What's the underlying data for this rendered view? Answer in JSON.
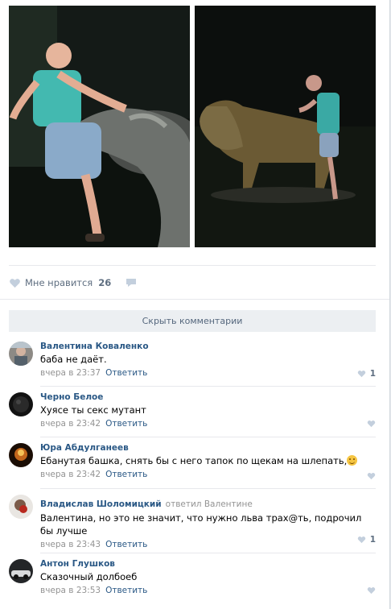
{
  "post": {
    "likes_label": "Мне нравится",
    "likes_count": "26",
    "hide_comments": "Скрыть комментарии"
  },
  "colors": {
    "link": "#2a5885",
    "muted": "#939393",
    "button_bg": "#eceff2"
  },
  "comments": [
    {
      "author": "Валентина Коваленко",
      "note": "",
      "text": "баба не даёт.",
      "date": "вчера в 23:37",
      "reply": "Ответить",
      "likes": "1"
    },
    {
      "author": "Черно Белое",
      "note": "",
      "text": "Хуясе ты секс мутант",
      "date": "вчера в 23:42",
      "reply": "Ответить",
      "likes": ""
    },
    {
      "author": "Юра Абдулганеев",
      "note": "",
      "text": "Ебанутая башка, снять бы с него тапок по щекам на шлепать,",
      "date": "вчера в 23:42",
      "reply": "Ответить",
      "likes": ""
    },
    {
      "author": "Владислав Шоломицкий",
      "note": "ответил Валентине",
      "text": "Валентина, но это не значит, что нужно льва трах@ть, подрочил бы лучше",
      "date": "вчера в 23:43",
      "reply": "Ответить",
      "likes": "1"
    },
    {
      "author": "Антон Глушков",
      "note": "",
      "text": "Сказочный долбоеб",
      "date": "вчера в 23:53",
      "reply": "Ответить",
      "likes": ""
    }
  ]
}
